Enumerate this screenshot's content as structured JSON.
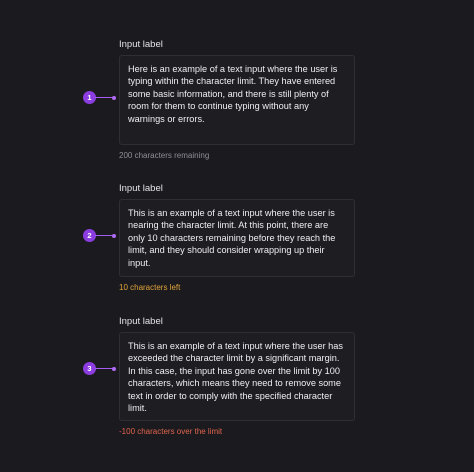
{
  "fields": [
    {
      "label": "Input label",
      "value": "Here is an example of a text input where the user is typing within the character limit. They have entered some basic information, and there is still plenty of room for them to continue typing without any warnings or errors.",
      "helper": "200 characters remaining",
      "marker": "1"
    },
    {
      "label": "Input label",
      "value": "This is an example of a text input where the user is nearing the character limit. At this point, there are only 10 characters remaining before they reach the limit, and they should consider wrapping up their input.",
      "helper": "10 characters left",
      "marker": "2"
    },
    {
      "label": "Input label",
      "value": "This is an example of a text input where the user has exceeded the character limit by a significant margin. In this case, the input has gone over the limit by 100 characters, which means they need to remove some text in order to comply with the specified character limit.",
      "helper": "-100 characters over the limit",
      "marker": "3"
    }
  ],
  "colors": {
    "background": "#1b1a1e",
    "marker": "#8b3ddf",
    "warning": "#e1a43a",
    "error": "#e0654e",
    "helper": "#8f8e96"
  }
}
